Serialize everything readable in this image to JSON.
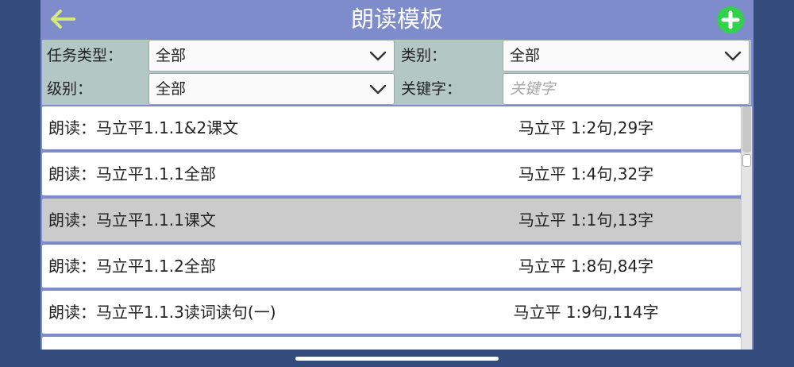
{
  "header": {
    "title": "朗读模板",
    "back_icon": "arrow-left-icon",
    "add_icon": "plus-circle-icon",
    "back_color": "#d8e87a",
    "add_color": "#2fd24a"
  },
  "filters": {
    "task_type": {
      "label": "任务类型：",
      "value": "全部"
    },
    "category": {
      "label": "类别：",
      "value": "全部"
    },
    "level": {
      "label": "级别：",
      "value": "全部"
    },
    "keyword": {
      "label": "关键字：",
      "placeholder": "关键字",
      "value": ""
    }
  },
  "list": {
    "selected_index": 2,
    "items": [
      {
        "name": "朗读：马立平1.1.1&2课文",
        "stats": "马立平 1:2句,29字"
      },
      {
        "name": "朗读：马立平1.1.1全部",
        "stats": "马立平 1:4句,32字"
      },
      {
        "name": "朗读：马立平1.1.1课文",
        "stats": "马立平 1:1句,13字"
      },
      {
        "name": "朗读：马立平1.1.2全部",
        "stats": "马立平 1:8句,84字"
      },
      {
        "name": "朗读：马立平1.1.3读词读句(一)",
        "stats": "马立平 1:9句,114字"
      },
      {
        "name": "",
        "stats": ""
      }
    ]
  }
}
